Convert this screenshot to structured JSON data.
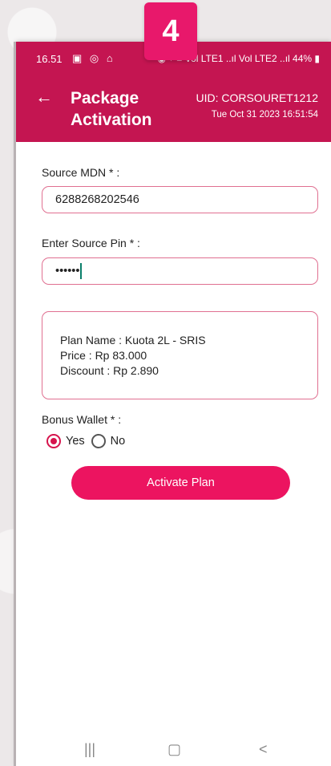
{
  "badge": "4",
  "status": {
    "time": "16.51",
    "left_icons": "▣ ◎ ⌂",
    "right_icons": "◉ ⌖ ≡ Vol LTE1 ..ıl Vol LTE2 ..ıl 44% ▮"
  },
  "header": {
    "title": "Package Activation",
    "uid": "UID: CORSOURET1212",
    "timestamp": "Tue Oct 31 2023 16:51:54"
  },
  "form": {
    "source_mdn_label": "Source MDN * :",
    "source_mdn_value": "6288268202546",
    "pin_label": "Enter Source Pin * :",
    "pin_value": "••••••"
  },
  "plan": {
    "name": "Plan Name : Kuota 2L - SRIS",
    "price": "Price : Rp 83.000",
    "discount": "Discount : Rp 2.890"
  },
  "bonus_wallet": {
    "label": "Bonus Wallet * :",
    "yes_label": "Yes",
    "no_label": "No",
    "selected": "Yes"
  },
  "activate_label": "Activate Plan",
  "nav": {
    "recents": "|||",
    "home": "▢",
    "back": "<"
  },
  "colors": {
    "header": "#c41551",
    "accent": "#ec1460",
    "border": "#e07091",
    "badge": "#e8186b"
  }
}
